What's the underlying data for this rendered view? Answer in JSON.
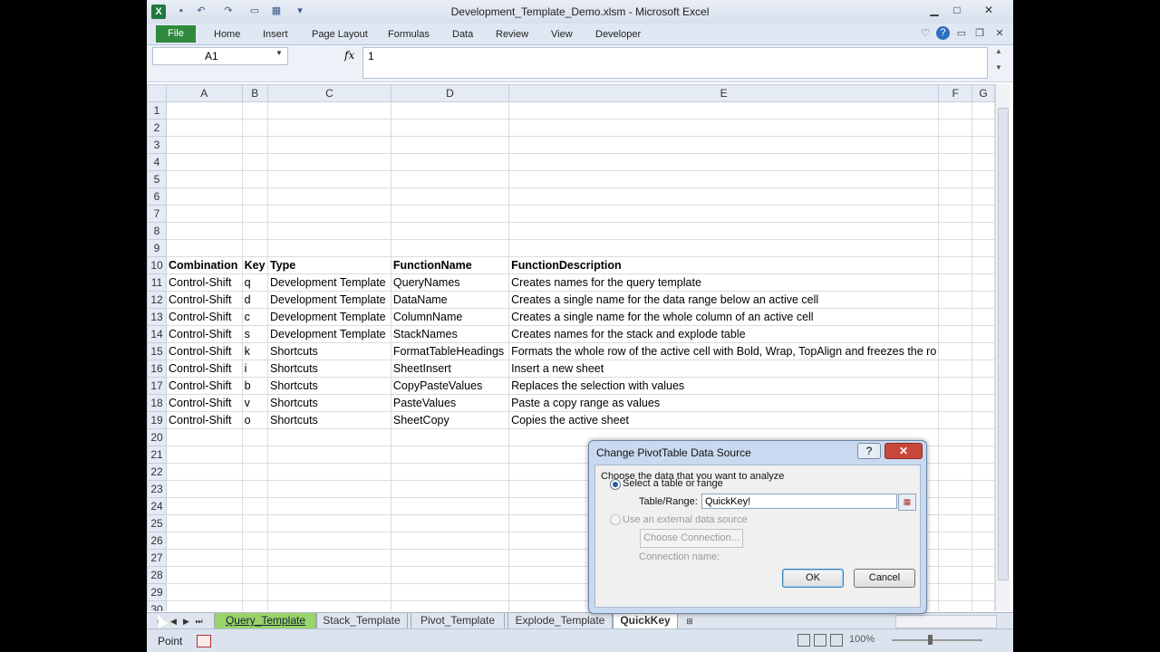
{
  "window": {
    "title": "Development_Template_Demo.xlsm - Microsoft Excel",
    "quick_access_icons": [
      "save-icon",
      "undo-icon",
      "redo-icon",
      "print-icon",
      "format-icon",
      "customize-icon"
    ],
    "controls": {
      "minimize": "▁",
      "maximize": "□",
      "close": "✕"
    }
  },
  "ribbon": {
    "file_label": "File",
    "tabs": [
      "Home",
      "Insert",
      "Page Layout",
      "Formulas",
      "Data",
      "Review",
      "View",
      "Developer"
    ],
    "right_icons": [
      "minimize-ribbon-icon",
      "help-icon",
      "window-min-icon",
      "window-restore-icon",
      "window-close-icon"
    ]
  },
  "formula_bar": {
    "name_box": "A1",
    "fx_label": "fx",
    "formula_value": "1"
  },
  "sheet": {
    "columns": [
      "A",
      "B",
      "C",
      "D",
      "E",
      "F",
      "G"
    ],
    "row_numbers": [
      "1",
      "2",
      "3",
      "4",
      "5",
      "6",
      "7",
      "8",
      "9",
      "10",
      "11",
      "12",
      "13",
      "14",
      "15",
      "16",
      "17",
      "18",
      "19",
      "20",
      "21",
      "22",
      "23",
      "24",
      "25",
      "26",
      "27",
      "28",
      "29",
      "30"
    ],
    "header_row": {
      "row": "10",
      "cells": [
        "Combination",
        "Key",
        "Type",
        "FunctionName",
        "FunctionDescription",
        "",
        ""
      ]
    },
    "data_rows": [
      {
        "row": "11",
        "cells": [
          "Control-Shift",
          "q",
          "Development Template",
          "QueryNames",
          "Creates names for the query template",
          "",
          ""
        ]
      },
      {
        "row": "12",
        "cells": [
          "Control-Shift",
          "d",
          "Development Template",
          "DataName",
          "Creates a single name for the data range below an active cell",
          "",
          ""
        ]
      },
      {
        "row": "13",
        "cells": [
          "Control-Shift",
          "c",
          "Development Template",
          "ColumnName",
          "Creates a single name for the whole column of an active cell",
          "",
          ""
        ]
      },
      {
        "row": "14",
        "cells": [
          "Control-Shift",
          "s",
          "Development Template",
          "StackNames",
          "Creates names for the stack and explode table",
          "",
          ""
        ]
      },
      {
        "row": "15",
        "cells": [
          "Control-Shift",
          "k",
          "Shortcuts",
          "FormatTableHeadings",
          "Formats the whole row of the active cell with Bold, Wrap, TopAlign and freezes the ro",
          "",
          ""
        ]
      },
      {
        "row": "16",
        "cells": [
          "Control-Shift",
          "i",
          "Shortcuts",
          "SheetInsert",
          "Insert a new sheet",
          "",
          ""
        ]
      },
      {
        "row": "17",
        "cells": [
          "Control-Shift",
          "b",
          "Shortcuts",
          "CopyPasteValues",
          "Replaces the selection with values",
          "",
          ""
        ]
      },
      {
        "row": "18",
        "cells": [
          "Control-Shift",
          "v",
          "Shortcuts",
          "PasteValues",
          "Paste a copy range as values",
          "",
          ""
        ]
      },
      {
        "row": "19",
        "cells": [
          "Control-Shift",
          "o",
          "Shortcuts",
          "SheetCopy",
          "Copies the active sheet",
          "",
          ""
        ]
      }
    ]
  },
  "sheet_tabs": {
    "nav": [
      "⏮",
      "◀",
      "▶",
      "⏭"
    ],
    "tabs": [
      {
        "label": "Query_Template",
        "state": "green"
      },
      {
        "label": "Stack_Template",
        "state": "normal"
      },
      {
        "label": "Pivot_Template",
        "state": "normal"
      },
      {
        "label": "Explode_Template",
        "state": "normal"
      },
      {
        "label": "QuickKey",
        "state": "active"
      }
    ]
  },
  "status_bar": {
    "mode": "Point",
    "zoom": "100%"
  },
  "dialog": {
    "title": "Change PivotTable Data Source",
    "help": "?",
    "close": "✕",
    "instruction": "Choose the data that you want to analyze",
    "option_table": "Select a table or range",
    "table_range_label": "Table/Range:",
    "table_range_value": "QuickKey!",
    "option_external": "Use an external data source",
    "choose_connection": "Choose Connection...",
    "connection_name_label": "Connection name:",
    "ok": "OK",
    "cancel": "Cancel"
  },
  "colors": {
    "file_tab": "#2f8a3d",
    "green_tab": "#9ad36a",
    "dialog_frame": "#c9daf0",
    "close_button": "#c9463b"
  }
}
